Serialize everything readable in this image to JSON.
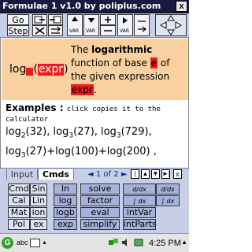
{
  "window": {
    "title": "Formulae 1 v1.0 by poliplus.com",
    "close_label": "x"
  },
  "toolbar": {
    "go_label": "Go",
    "step_label": "Step",
    "var_label": "VAR",
    "arrow_label": "→",
    "move_icon": "four-way-arrows"
  },
  "description": {
    "formula_func": "log",
    "formula_arg": "expr",
    "text_prefix": "The ",
    "text_bold": "logarithmic",
    "text_mid": " function of base ",
    "base_box": "e",
    "text_end": " of the given expression ",
    "expr_box": "expr",
    "text_tail": "."
  },
  "examples": {
    "heading": "Examples",
    "colon": " : ",
    "note_a": "click copies it to the",
    "note_b": "calculator",
    "line1": [
      {
        "f": "log",
        "sub": "2",
        "arg": "(32)"
      },
      {
        "f": "log",
        "sub": "3",
        "arg": "(27)"
      },
      {
        "f": "log",
        "sub": "3",
        "arg": "(729)"
      }
    ],
    "line2": "log",
    "line2_sub": "3",
    "line2_rest": "(27)+log(100)+log(200) ,"
  },
  "tabs": {
    "input_label": "Input",
    "cmds_label": "Cmds",
    "page_label": "1 of 2"
  },
  "keypad": {
    "col1": [
      "Cmd",
      "Cal",
      "Mat",
      "Pol"
    ],
    "col2": [
      "Sin",
      "Lin",
      "ion",
      "ex"
    ],
    "col3": [
      "ln",
      "log",
      "logb",
      "exp"
    ],
    "col4": [
      "solve",
      "factor",
      "eval",
      "simplify"
    ],
    "col5": [
      "d/dx",
      "∫ dx",
      "∫ dx",
      "intParts"
    ],
    "col5_mid": "intVar"
  },
  "taskbar": {
    "abc_label": "abc",
    "clock": "4:25 PM"
  },
  "colors": {
    "title_bg": "#1a1a40",
    "toolbar_bg": "#c7cfe6",
    "desc_bg": "#f9d1a0",
    "placeholder_red": "#ee1b1b"
  }
}
